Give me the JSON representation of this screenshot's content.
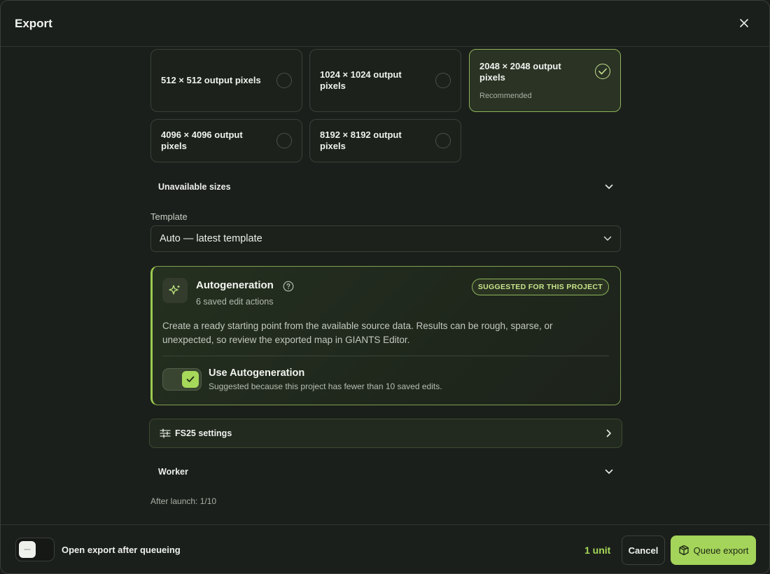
{
  "dialog": {
    "title": "Export"
  },
  "sizes": [
    {
      "label": "512 × 512 output pixels",
      "sub": "",
      "selected": false
    },
    {
      "label": "1024 × 1024 output pixels",
      "sub": "",
      "selected": false
    },
    {
      "label": "2048 × 2048 output pixels",
      "sub": "Recommended",
      "selected": true
    },
    {
      "label": "4096 × 4096 output pixels",
      "sub": "",
      "selected": false
    },
    {
      "label": "8192 × 8192 output pixels",
      "sub": "",
      "selected": false
    }
  ],
  "unavailable": {
    "label": "Unavailable sizes"
  },
  "template": {
    "label": "Template",
    "value": "Auto — latest template"
  },
  "autogen": {
    "title": "Autogeneration",
    "subtitle": "6 saved edit actions",
    "badge": "SUGGESTED FOR THIS PROJECT",
    "description": "Create a ready starting point from the available source data. Results can be rough, sparse, or unexpected, so review the exported map in GIANTS Editor.",
    "toggle_title": "Use Autogeneration",
    "toggle_sub": "Suggested because this project has fewer than 10 saved edits.",
    "enabled": true
  },
  "fs25": {
    "label": "FS25 settings"
  },
  "worker": {
    "label": "Worker"
  },
  "after_launch": "After launch: 1/10",
  "footer": {
    "open_label": "Open export after queueing",
    "open_enabled": false,
    "units": "1 unit",
    "cancel": "Cancel",
    "queue": "Queue export"
  },
  "colors": {
    "accent": "#a6d85a",
    "background": "#1b1f1b",
    "border": "#3a4039"
  }
}
